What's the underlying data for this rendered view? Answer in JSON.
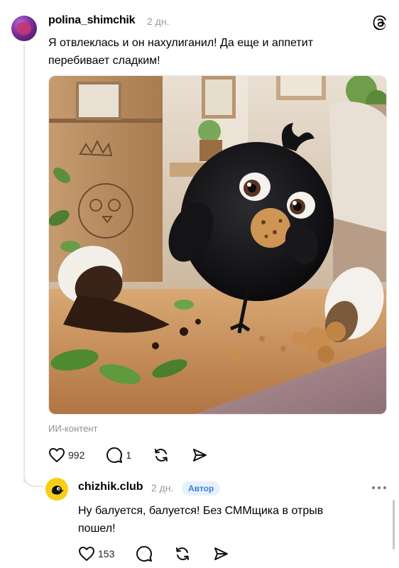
{
  "post": {
    "username": "polina_shimchik",
    "time": "2 дн.",
    "text": "Я отвлеклась и он нахулиганил! Да еще и аппетит перебивает сладким!",
    "content_label": "ИИ-контент",
    "likes": "992",
    "comments": "1"
  },
  "reply": {
    "username": "chizhik.club",
    "time": "2 дн.",
    "badge": "Автор",
    "text": "Ну балуется, балуется! Без СММщика в отрыв пошел!",
    "likes": "153"
  },
  "icons": {
    "app_logo": "threads-logo-icon",
    "like": "heart-icon",
    "comment": "comment-icon",
    "repost": "repost-icon",
    "share": "share-icon",
    "more": "more-dots-icon"
  }
}
